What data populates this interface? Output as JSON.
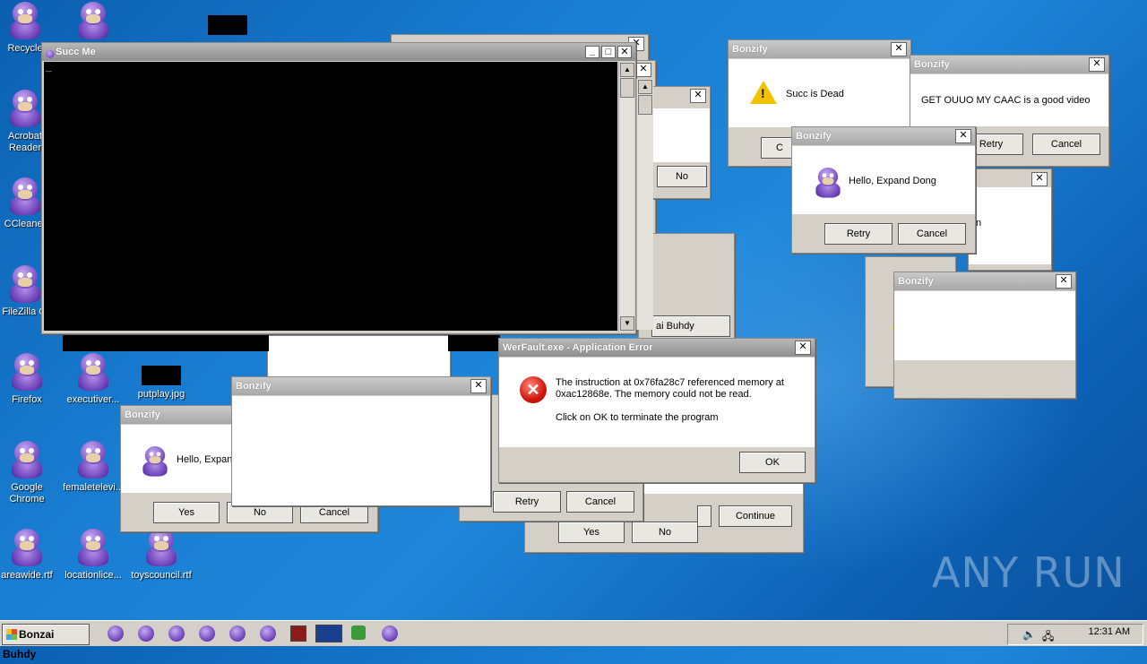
{
  "desktop": {
    "icons": [
      {
        "label": "Recycle"
      },
      {
        "label": "Acrobat Reader"
      },
      {
        "label": "CCleaner"
      },
      {
        "label": "FileZilla Cl"
      },
      {
        "label": "Firefox"
      },
      {
        "label": "Google Chrome"
      },
      {
        "label": "areawide.rtf"
      },
      {
        "label": "executiver..."
      },
      {
        "label": "putplay.jpg"
      },
      {
        "label": "femaletelevi..."
      },
      {
        "label": "locationlice..."
      },
      {
        "label": "toyscouncil.rtf"
      }
    ],
    "watermark": "ANY RUN"
  },
  "console": {
    "title": "Succ Me",
    "cursor": "_"
  },
  "dialogs": {
    "succ_dead": {
      "title": "Bonzify",
      "message": "Succ is Dead",
      "btn_partial": "C"
    },
    "caac": {
      "title": "Bonzify",
      "message": "GET OUUO MY CAAC is a good video",
      "retry": "Retry",
      "cancel": "Cancel"
    },
    "expand_dong": {
      "title": "Bonzify",
      "message": "Hello, Expand Dong",
      "retry": "Retry",
      "cancel": "Cancel"
    },
    "empty_right": {
      "title": "Bonzify"
    },
    "behind_right_partial": {
      "text": "n"
    },
    "left_expan": {
      "title": "Bonzify",
      "message": "Hello, Expan",
      "yes": "Yes",
      "no": "No",
      "cancel": "Cancel"
    },
    "empty_mid": {
      "title": "Bonzify"
    },
    "werfault": {
      "title": "WerFault.exe - Application Error",
      "line1": "The instruction at 0x76fa28c7 referenced memory at",
      "line2": "0xac12868e. The memory could not be read.",
      "line3": "Click on OK to terminate the program",
      "ok": "OK"
    },
    "behind_bottom": {
      "retry": "Retry",
      "cancel": "Cancel",
      "continue": "Continue",
      "yes": "Yes",
      "no": "No"
    },
    "behind_top": {
      "no": "No",
      "partial_button": "ai Buhdy"
    }
  },
  "taskbar": {
    "start_label": "Bonzai Buhdy",
    "clock": "12:31 AM"
  },
  "close_glyph": "✕"
}
